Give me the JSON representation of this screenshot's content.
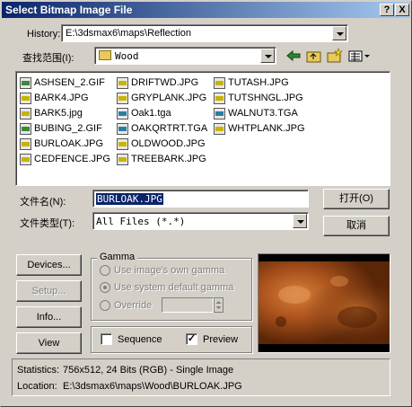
{
  "window": {
    "title": "Select Bitmap Image File",
    "help_btn": "?",
    "close_btn": "X"
  },
  "history": {
    "label": "History:",
    "value": "E:\\3dsmax6\\maps\\Reflection"
  },
  "lookin": {
    "label": "查找范围(I):",
    "value": "Wood"
  },
  "files": {
    "col1": [
      {
        "name": "ASHSEN_2.GIF",
        "type": "gif"
      },
      {
        "name": "BARK4.JPG",
        "type": "jpg"
      },
      {
        "name": "BARK5.jpg",
        "type": "jpg"
      },
      {
        "name": "BUBING_2.GIF",
        "type": "gif"
      },
      {
        "name": "BURLOAK.JPG",
        "type": "jpg"
      },
      {
        "name": "CEDFENCE.JPG",
        "type": "jpg"
      }
    ],
    "col2": [
      {
        "name": "DRIFTWD.JPG",
        "type": "jpg"
      },
      {
        "name": "GRYPLANK.JPG",
        "type": "jpg"
      },
      {
        "name": "Oak1.tga",
        "type": "tga"
      },
      {
        "name": "OAKQRTRT.TGA",
        "type": "tga"
      },
      {
        "name": "OLDWOOD.JPG",
        "type": "jpg"
      },
      {
        "name": "TREEBARK.JPG",
        "type": "jpg"
      }
    ],
    "col3": [
      {
        "name": "TUTASH.JPG",
        "type": "jpg"
      },
      {
        "name": "TUTSHNGL.JPG",
        "type": "jpg"
      },
      {
        "name": "WALNUT3.TGA",
        "type": "tga"
      },
      {
        "name": "WHTPLANK.JPG",
        "type": "jpg"
      }
    ]
  },
  "filename": {
    "label": "文件名(N):",
    "value": "BURLOAK.JPG"
  },
  "filetype": {
    "label": "文件类型(T):",
    "value": "All Files (*.*)"
  },
  "buttons": {
    "open": "打开(O)",
    "cancel": "取消",
    "devices": "Devices...",
    "setup": "Setup...",
    "info": "Info...",
    "view": "View"
  },
  "gamma": {
    "title": "Gamma",
    "own": "Use image's own gamma",
    "system": "Use system default gamma",
    "override": "Override"
  },
  "options": {
    "sequence": "Sequence",
    "preview": "Preview",
    "preview_checked": true,
    "sequence_checked": false
  },
  "statistics": {
    "label": "Statistics:",
    "value": "756x512, 24 Bits (RGB) - Single Image"
  },
  "location": {
    "label": "Location:",
    "value": "E:\\3dsmax6\\maps\\Wood\\BURLOAK.JPG"
  }
}
